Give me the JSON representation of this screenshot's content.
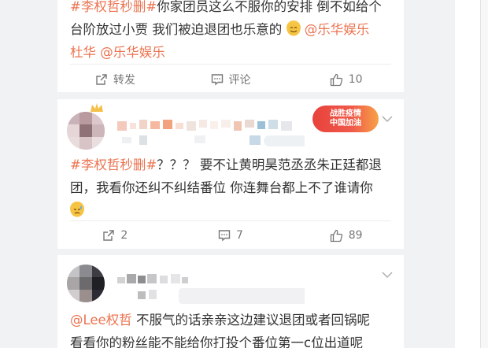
{
  "posts": [
    {
      "text_parts": {
        "hashtag": "#李权哲秒删#",
        "body": "你家团员这么不服你的安排 倒不如给个台阶放过小贾 我们被迫退团也乐意的",
        "mention1": "@乐华娱乐",
        "mention2": "杜华",
        "mention3": "@乐华娱乐"
      },
      "actions": {
        "repost": "转发",
        "comment": "评论",
        "like": "10"
      }
    },
    {
      "text_parts": {
        "hashtag": "#李权哲秒删#",
        "body": "？？？ 要不让黄明昊范丞丞朱正廷都退团，我看你还纠不纠结番位 你连舞台都上不了谁请你"
      },
      "badge": {
        "line1": "战胜疫情",
        "line2": "中国加油"
      },
      "actions": {
        "repost": "2",
        "comment": "7",
        "like": "89"
      }
    },
    {
      "text_parts": {
        "mention": "@Lee权哲",
        "body1": " 不服气的话亲亲这边建议退团或者回锅呢",
        "body2": "看看你的粉丝能不能给你打投个番位第一c位出道呢"
      }
    }
  ],
  "icons": {
    "repost": "share-icon",
    "comment": "comment-icon",
    "like": "thumbs-up-icon",
    "menu": "chevron-down-icon"
  },
  "colors": {
    "link": "#eb7350",
    "text": "#333333",
    "meta": "#777777"
  }
}
